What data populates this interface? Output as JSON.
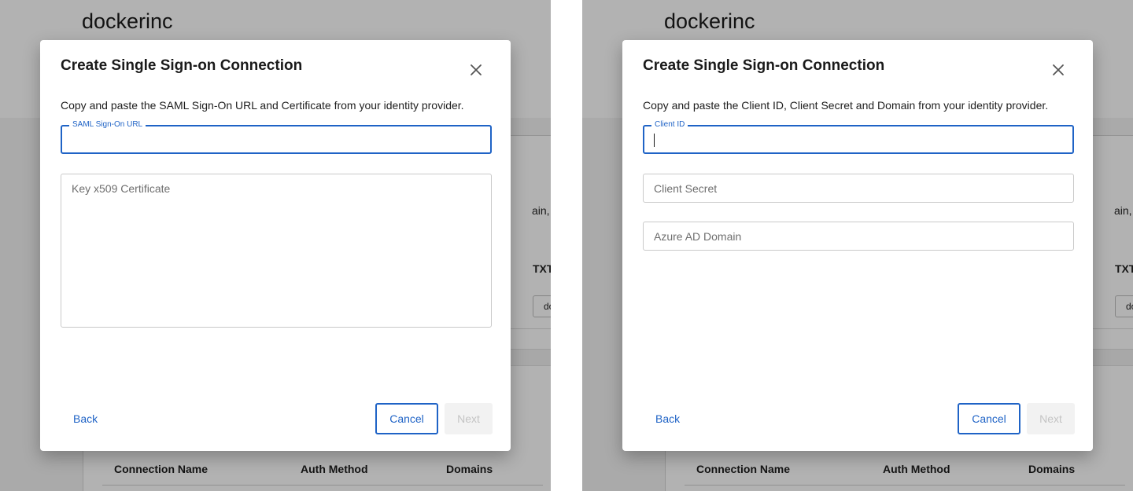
{
  "background": {
    "org_name": "dockerinc",
    "snippet_text": "ain, add",
    "record_type_header": "TXT",
    "record_chip": "do",
    "table_headers": [
      "Connection Name",
      "Auth Method",
      "Domains"
    ]
  },
  "saml_dialog": {
    "title": "Create Single Sign-on Connection",
    "close_icon": "close-icon",
    "description": "Copy and paste the SAML Sign-On URL and Certificate from your identity provider.",
    "url_label": "SAML Sign-On URL",
    "url_value": "",
    "certificate_placeholder": "Key x509 Certificate",
    "back_label": "Back",
    "cancel_label": "Cancel",
    "next_label": "Next"
  },
  "azure_dialog": {
    "title": "Create Single Sign-on Connection",
    "close_icon": "close-icon",
    "description": "Copy and paste the Client ID, Client Secret and Domain from your identity provider.",
    "client_id_label": "Client ID",
    "client_id_value": "",
    "client_secret_placeholder": "Client Secret",
    "domain_placeholder": "Azure AD Domain",
    "back_label": "Back",
    "cancel_label": "Cancel",
    "next_label": "Next"
  },
  "colors": {
    "accent": "#1f63c6",
    "overlay": "rgba(0,0,0,0.30)",
    "disabled_bg": "#f2f2f2"
  }
}
